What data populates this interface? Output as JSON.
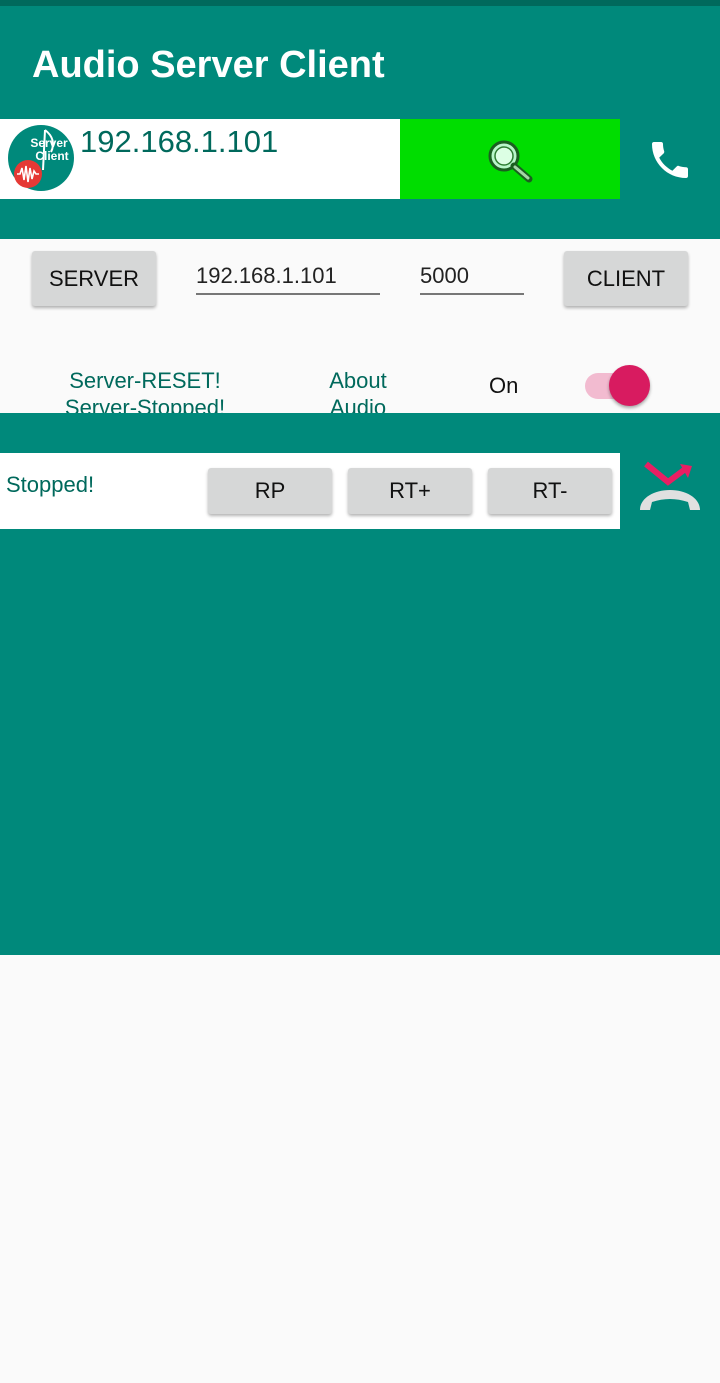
{
  "app": {
    "title": "Audio Server Client"
  },
  "logo": {
    "text_line1": "Server",
    "text_line2": "Client"
  },
  "top_bar": {
    "ip_display": "192.168.1.101"
  },
  "controls": {
    "server_button": "SERVER",
    "ip_input": "192.168.1.101",
    "port_input": "5000",
    "client_button": "CLIENT"
  },
  "status": {
    "server_line1": "Server-RESET!",
    "server_line2": "Server-Stopped!",
    "about_line1": "About",
    "about_line2": "Audio",
    "switch_label": "On"
  },
  "playback": {
    "status_text": "Stopped!",
    "rp_button": "RP",
    "rt_plus_button": "RT+",
    "rt_minus_button": "RT-"
  },
  "colors": {
    "primary": "#00897B",
    "primary_dark": "#00695C",
    "search_green": "#00DD00",
    "accent": "#D81B60"
  },
  "icons": {
    "search": "magnifier-icon",
    "call": "phone-icon",
    "hangup": "hangup-icon"
  }
}
